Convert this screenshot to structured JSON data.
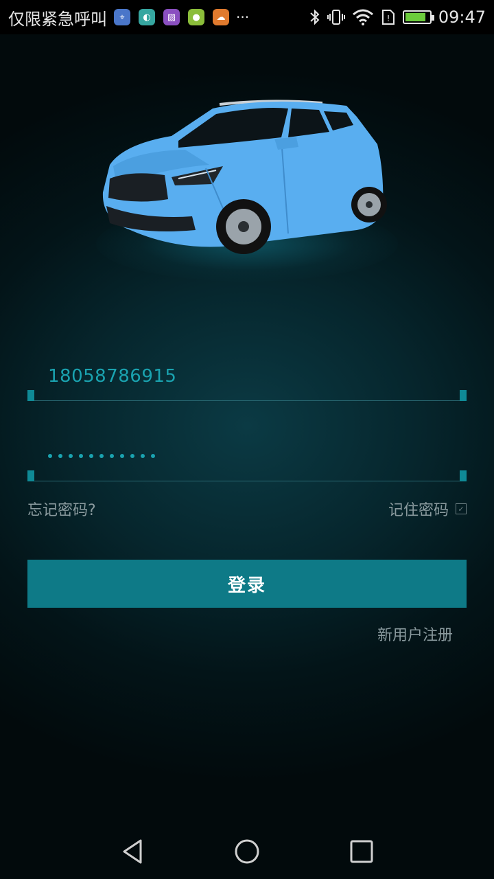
{
  "status_bar": {
    "carrier_text": "仅限紧急呼叫",
    "notification_icons": [
      {
        "name": "location-app-icon",
        "color": "#4a76c9",
        "glyph": "⌖"
      },
      {
        "name": "android-icon",
        "color": "#36a6a0",
        "glyph": "◐"
      },
      {
        "name": "gallery-icon",
        "color": "#8a4fc0",
        "glyph": "▨"
      },
      {
        "name": "map-app-icon",
        "color": "#8bbd3a",
        "glyph": "●"
      },
      {
        "name": "cloud-app-icon",
        "color": "#e07a2e",
        "glyph": "☁"
      }
    ],
    "more_glyph": "···",
    "time": "09:47",
    "battery_level": 0.85
  },
  "login_form": {
    "phone_value": "18058786915",
    "password_mask_count": 11,
    "forgot_password_label": "忘记密码?",
    "remember_password_label": "记住密码",
    "remember_checked": true,
    "login_button_label": "登录",
    "register_label": "新用户注册"
  },
  "colors": {
    "accent": "#0e7a87",
    "input_text": "#1aa3b0",
    "car_body": "#59aef0"
  }
}
